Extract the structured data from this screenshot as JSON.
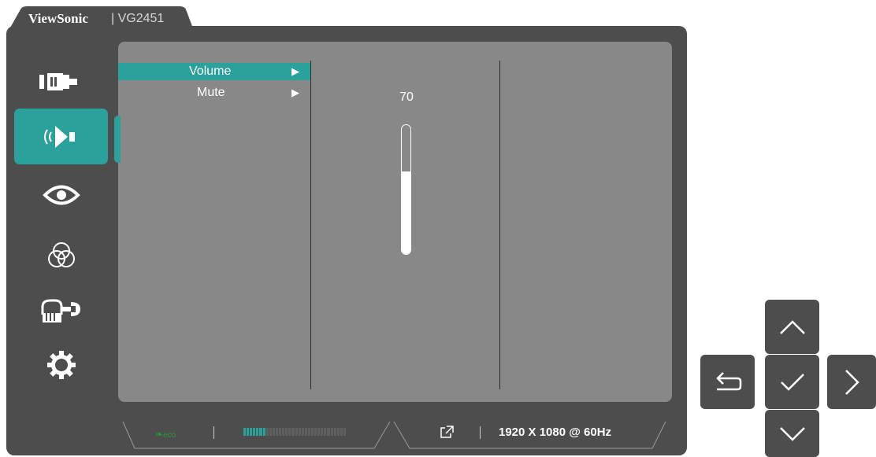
{
  "title": {
    "brand": "ViewSonic",
    "model": "| VG2451"
  },
  "sidebar": {
    "items": [
      {
        "icon": "input-source-icon",
        "active": false
      },
      {
        "icon": "audio-icon",
        "active": true
      },
      {
        "icon": "eye-icon",
        "active": false
      },
      {
        "icon": "color-circles-icon",
        "active": false
      },
      {
        "icon": "manual-setup-icon",
        "active": false
      },
      {
        "icon": "gear-icon",
        "active": false
      }
    ]
  },
  "menu": {
    "items": [
      {
        "label": "Volume",
        "arrow": "▶",
        "selected": true
      },
      {
        "label": "Mute",
        "arrow": "▶",
        "selected": false
      }
    ]
  },
  "volume": {
    "value": "70",
    "level": 0.64
  },
  "status_bar": {
    "eco_label": "eco",
    "eco_meter_level": 0.22,
    "resolution": "1920 X 1080 @ 60Hz"
  },
  "keypad": [
    "up-icon",
    "back-icon",
    "confirm-icon",
    "right-icon",
    "down-icon"
  ],
  "colors": {
    "accent": "#2aa19a",
    "frame": "#4d4d4d",
    "panel": "#888888"
  }
}
